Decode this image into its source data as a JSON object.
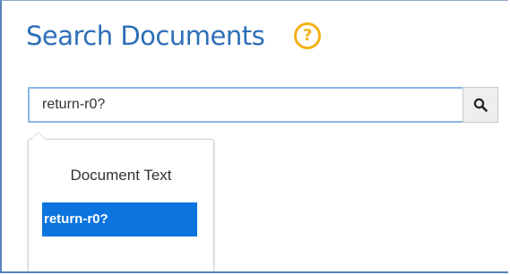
{
  "header": {
    "title": "Search Documents",
    "help_glyph": "?",
    "help_icon": "question-circle-icon"
  },
  "search": {
    "value": "return-r0?",
    "button_icon": "search-icon"
  },
  "suggestions": {
    "header": "Document Text",
    "items": [
      {
        "label": "return-r0?",
        "selected": true
      }
    ]
  },
  "colors": {
    "title": "#2d6fb7",
    "help_icon": "#f2b316",
    "input_focus_border": "#8ab4e8",
    "selected_item_bg": "#0b74de"
  }
}
